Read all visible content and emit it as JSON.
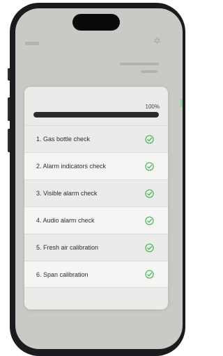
{
  "progress": {
    "label": "100%",
    "fraction": 1.0
  },
  "checklist": [
    {
      "label": "1.  Gas bottle check",
      "status": "check-circle-icon"
    },
    {
      "label": "2.  Alarm indicators check",
      "status": "check-circle-icon"
    },
    {
      "label": "3.  Visible alarm check",
      "status": "check-circle-icon"
    },
    {
      "label": "4.  Audio alarm check",
      "status": "check-circle-icon"
    },
    {
      "label": "5.  Fresh air calibration",
      "status": "check-circle-icon"
    },
    {
      "label": "6.  Span calibration",
      "status": "check-circle-icon"
    }
  ],
  "colors": {
    "accent_green": "#3bb54a",
    "progress_fill": "#2a2a2a"
  }
}
